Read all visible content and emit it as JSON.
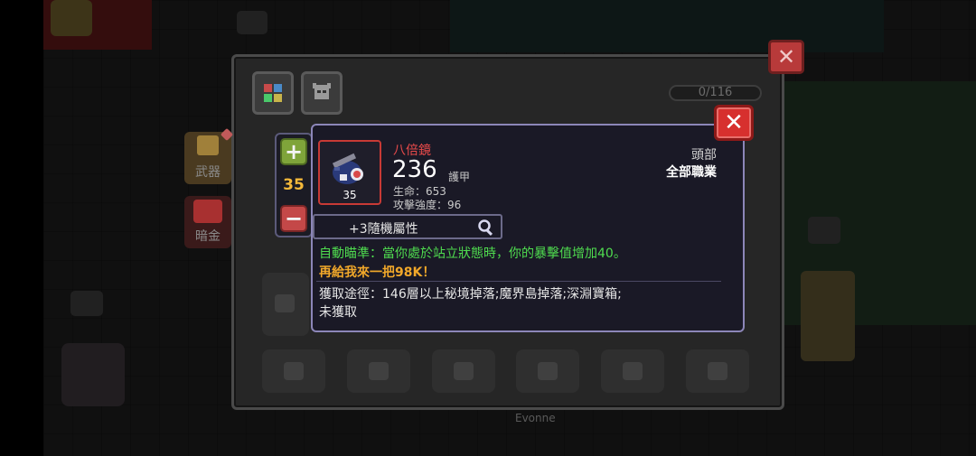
{
  "inventory": {
    "count_label": "0/116",
    "side_tabs": [
      {
        "label": "武器"
      },
      {
        "label": "暗金"
      }
    ]
  },
  "stepper": {
    "value": "35"
  },
  "item": {
    "name": "八倍鏡",
    "power": "236",
    "type": "護甲",
    "quantity": "35",
    "stats": [
      {
        "label": "生命：",
        "value": "653"
      },
      {
        "label": "攻擊強度：",
        "value": "96"
      }
    ],
    "slot": "頭部",
    "job": "全部職業",
    "random_attr": "+3隨機屬性",
    "skill_effect": "自動瞄準：當你處於站立狀態時，你的暴擊值增加40。",
    "skill_quote": "再給我來一把98K！",
    "source_line": "獲取途徑：146層以上秘境掉落;魔界島掉落;深淵寶箱;",
    "status": "未獲取"
  },
  "scene": {
    "npc_name": "Evonne"
  },
  "colors": {
    "item_name": "#e74a4a",
    "skill_effect": "#4fdc4f",
    "skill_quote": "#f1a82a",
    "stepper_value": "#f5b93a",
    "close_red": "#d7302e",
    "plus_green": "#7fa43a"
  },
  "icons": {
    "tab1": "color-grid-icon",
    "tab2": "helmet-icon",
    "plus": "plus-icon",
    "minus": "minus-icon",
    "close": "close-icon",
    "search": "magnifier-icon",
    "item": "scope-helmet-icon"
  }
}
